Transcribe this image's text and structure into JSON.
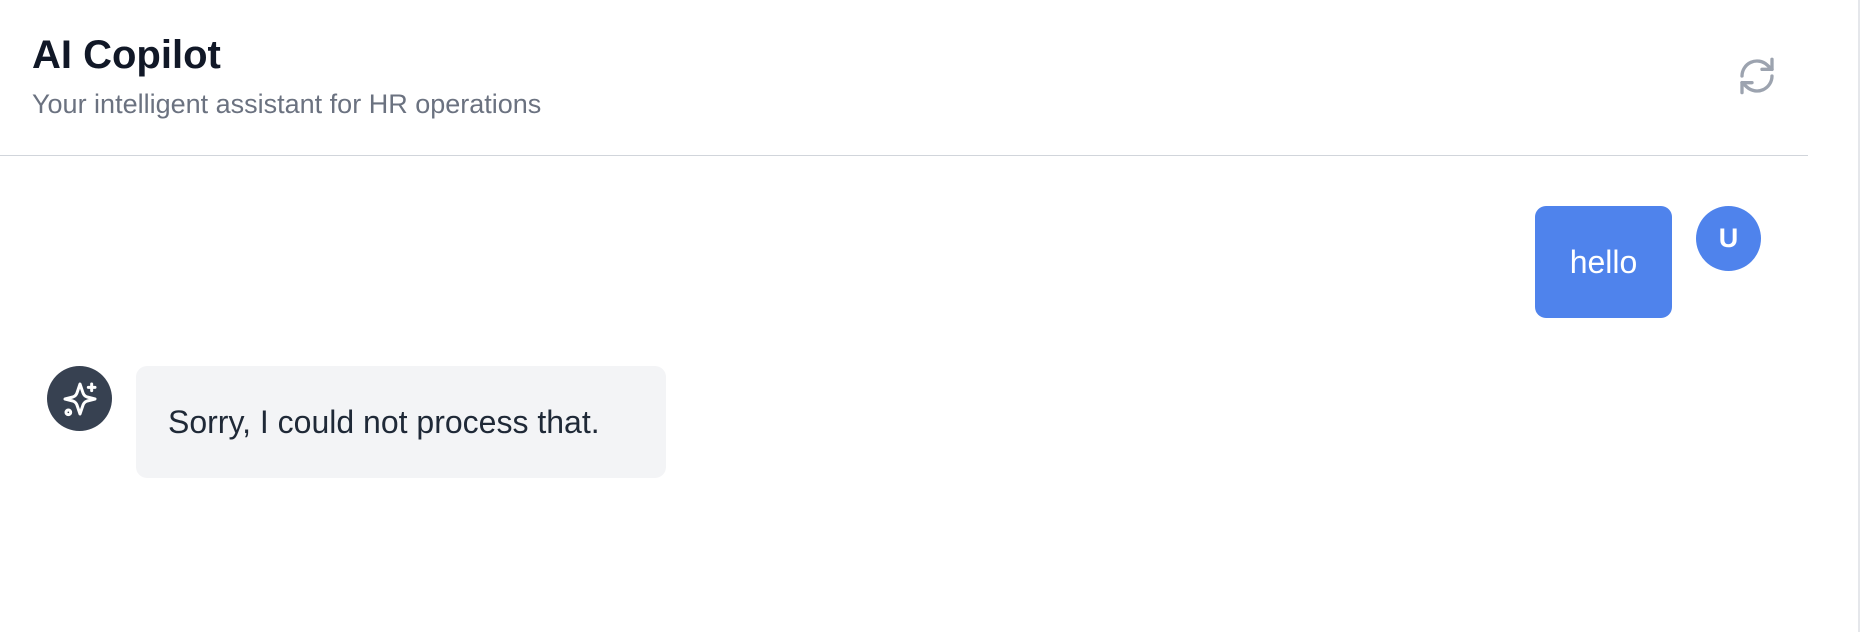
{
  "header": {
    "title": "AI Copilot",
    "subtitle": "Your intelligent assistant for HR operations",
    "refresh_icon": "refresh-icon"
  },
  "messages": [
    {
      "role": "user",
      "text": "hello",
      "avatar_initial": "U",
      "bubble_color": "#4f83ec"
    },
    {
      "role": "assistant",
      "text": "Sorry, I could not process that.",
      "avatar_icon": "sparkles-icon",
      "avatar_color": "#374151",
      "bubble_color": "#f3f4f6"
    }
  ],
  "colors": {
    "primary": "#4f83ec",
    "text_primary": "#111827",
    "text_secondary": "#6b7280",
    "divider": "#d1d5db"
  }
}
